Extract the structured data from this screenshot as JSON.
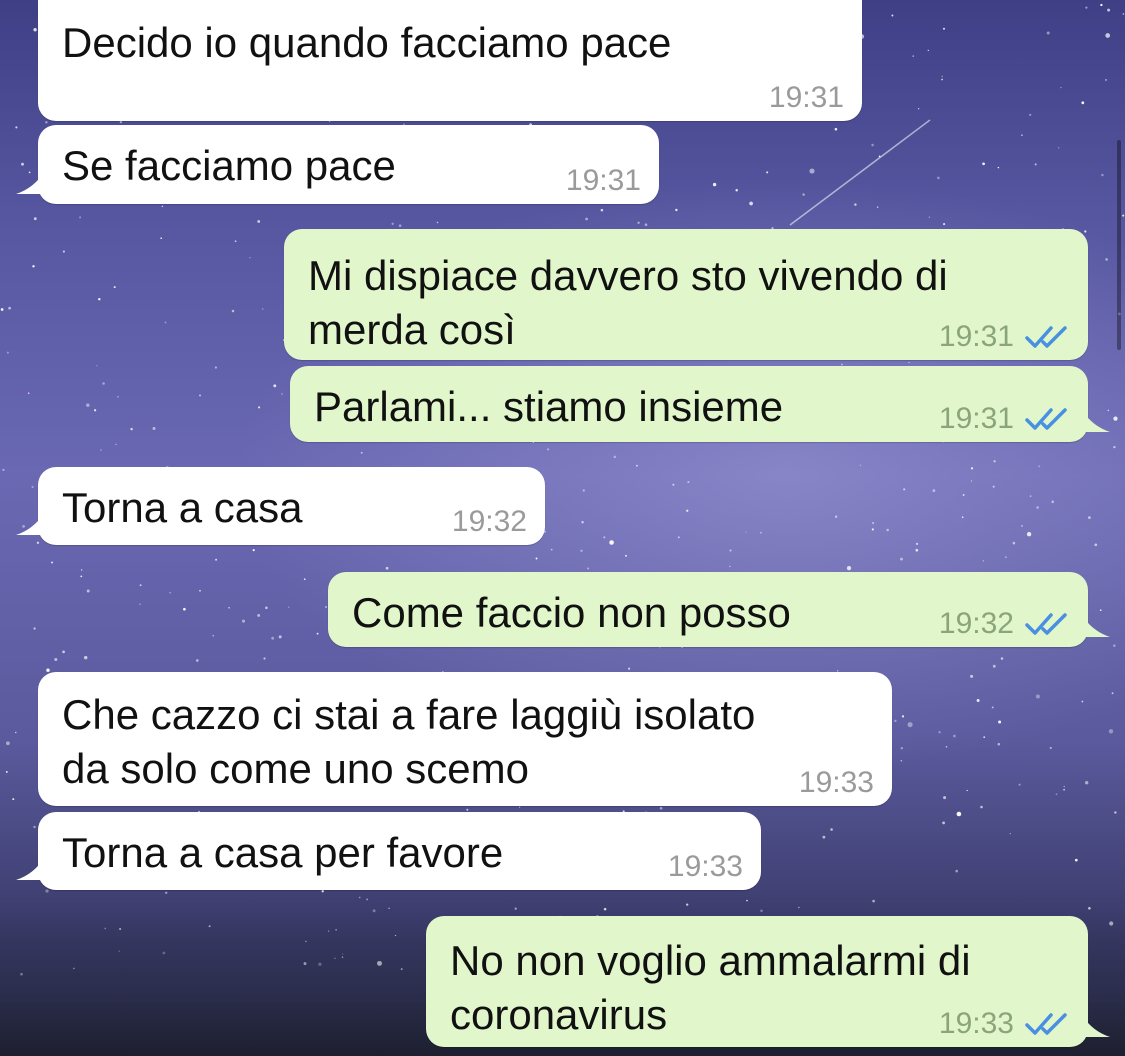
{
  "messages": [
    {
      "text": "Decido io quando facciamo pace",
      "time": "19:31",
      "direction": "in"
    },
    {
      "text": "Se facciamo pace",
      "time": "19:31",
      "direction": "in"
    },
    {
      "text": "Mi dispiace davvero sto vivendo di\nmerda così",
      "time": "19:31",
      "direction": "out",
      "status": "read"
    },
    {
      "text": "Parlami... stiamo insieme",
      "time": "19:31",
      "direction": "out",
      "status": "read"
    },
    {
      "text": "Torna a casa",
      "time": "19:32",
      "direction": "in"
    },
    {
      "text": "Come faccio non posso",
      "time": "19:32",
      "direction": "out",
      "status": "read"
    },
    {
      "text": "Che cazzo ci stai a fare laggiù isolato\nda solo come uno scemo",
      "time": "19:33",
      "direction": "in"
    },
    {
      "text": "Torna a casa per favore",
      "time": "19:33",
      "direction": "in"
    },
    {
      "text": "No non voglio ammalarmi di\ncoronavirus",
      "time": "19:33",
      "direction": "out",
      "status": "read"
    }
  ],
  "colors": {
    "incoming_bubble": "#ffffff",
    "outgoing_bubble": "#e1f7cb",
    "read_ticks": "#4a90e2",
    "timestamp": "#9a9a9a"
  },
  "icons": {
    "read_receipt": "double-check-icon"
  }
}
